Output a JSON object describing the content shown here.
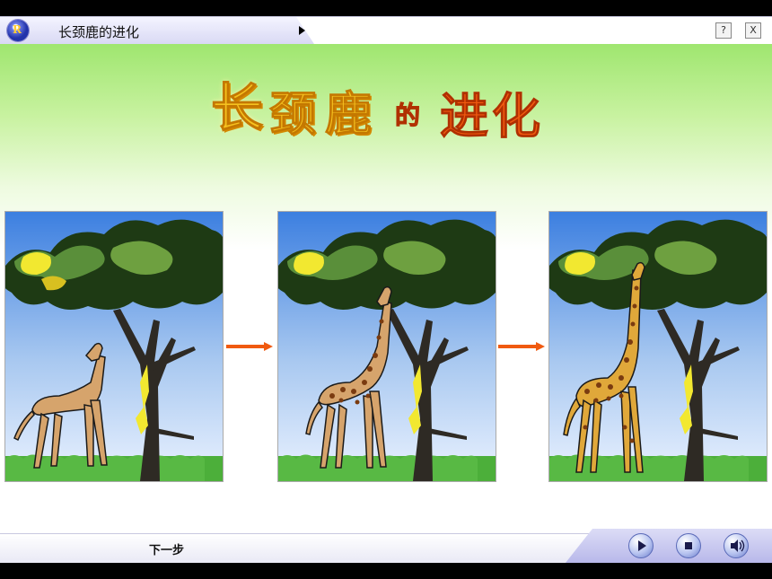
{
  "window": {
    "title": "长颈鹿的进化",
    "help_label": "?",
    "close_label": "X"
  },
  "slide": {
    "heading_chars": [
      "长",
      "颈",
      "鹿",
      "的",
      "进",
      "化"
    ],
    "panels": [
      {
        "stage": "short-neck giraffe ancestor"
      },
      {
        "stage": "medium-neck giraffe"
      },
      {
        "stage": "long-neck giraffe"
      }
    ]
  },
  "bottom": {
    "next_label": "下一步"
  },
  "icons": {
    "logo": "logo-icon",
    "play": "play-icon",
    "stop": "stop-icon",
    "sound": "sound-icon"
  },
  "colors": {
    "sky_top": "#3c7fe0",
    "grass": "#4caf3a",
    "giraffe_tan": "#d6a46c",
    "giraffe_spot_body": "#e0a83a",
    "spots": "#7a3b10",
    "arrow": "#f05a10",
    "title_yellow": "#f6c220",
    "title_orange": "#f05a10"
  }
}
